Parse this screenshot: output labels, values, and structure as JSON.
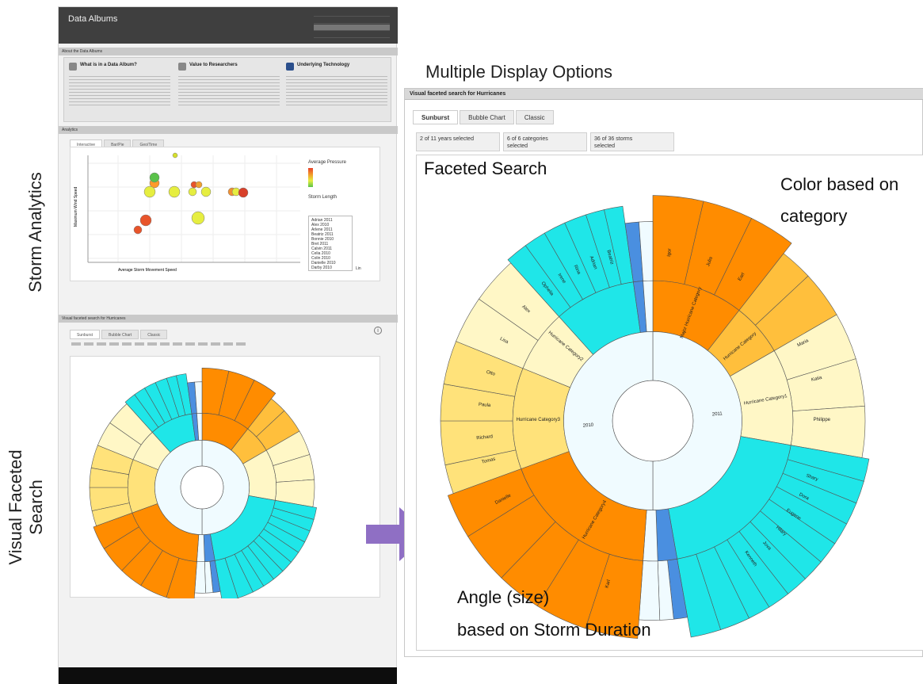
{
  "side_labels": {
    "storm_analytics": "Storm Analytics",
    "visual_faceted_line1": "Visual Faceted",
    "visual_faceted_line2": "Search"
  },
  "heading": "Multiple Display Options",
  "callouts": {
    "faceted_search": "Faceted Search",
    "color_line1": "Color based on",
    "color_line2": "category",
    "angle_line1": "Angle (size)",
    "angle_line2": "based on Storm Duration"
  },
  "small_app": {
    "title": "Data Albums",
    "about_panel": "About the Data Albums",
    "about_cols": [
      {
        "heading": "What is in a Data Album?"
      },
      {
        "heading": "Value to Researchers"
      },
      {
        "heading": "Underlying Technology"
      }
    ],
    "analytics_panel": "Analytics",
    "analytics_tabs": [
      "Interactive",
      "Bar/Pie",
      "Geo/Time"
    ],
    "scatter_xlabel": "Average Storm Movement Speed",
    "scatter_ylabel": "Maximum Wind Speed",
    "scatter_color_label": "Average Pressure",
    "scatter_size_label": "Storm Length",
    "scatter_scale_btn": "Lin",
    "scatter_storms": [
      "Adrian 2011",
      "Alex 2010",
      "Arlene 2011",
      "Beatriz 2011",
      "Bonnie 2010",
      "Bret 2011",
      "Calvin 2011",
      "Celia 2010",
      "Colin 2010",
      "Danielle 2010",
      "Darby 2010"
    ],
    "facet_panel": "Visual faceted search for Hurricanes",
    "facet_tabs": [
      "Sunburst",
      "Bubble Chart",
      "Classic"
    ],
    "facet_icon": "info-icon"
  },
  "big_view": {
    "title": "Visual faceted search for Hurricanes",
    "tabs": [
      "Sunburst",
      "Bubble Chart",
      "Classic"
    ],
    "active_tab": "Sunburst",
    "filters": [
      {
        "line1": "2 of 11 years selected",
        "line2": ""
      },
      {
        "line1": "6 of 6 categories",
        "line2": "selected"
      },
      {
        "line1": "36 of 36 storms",
        "line2": "selected"
      }
    ],
    "center_labels": [
      "2010",
      "2011"
    ],
    "category_labels": [
      "Hurricane Category1",
      "Hurricane Category2",
      "Hurricane Category3",
      "Hurricane Category4",
      "Major Hurricane Category",
      "Hurricane Category"
    ],
    "storm_labels": [
      "Igor",
      "Julia",
      "Earl",
      "Danielle",
      "Tomas",
      "Richard",
      "Paula",
      "Otto",
      "Lisa",
      "Alex",
      "Karl",
      "Shary",
      "Maria",
      "Katia",
      "Philippe",
      "Ophelia",
      "Irene",
      "Rina",
      "Adrian",
      "Beatriz",
      "Dora",
      "Eugene",
      "Hilary",
      "Jova",
      "Kenneth"
    ]
  },
  "colors": {
    "cyan": "#1FE6E8",
    "orange": "#FF8C00",
    "gold": "#FFBF3C",
    "yellow": "#FFE27A",
    "cream": "#FFF7C6",
    "blue": "#4A8FE0",
    "center": "#F0FBFF",
    "arrow": "#8F6FC4"
  }
}
